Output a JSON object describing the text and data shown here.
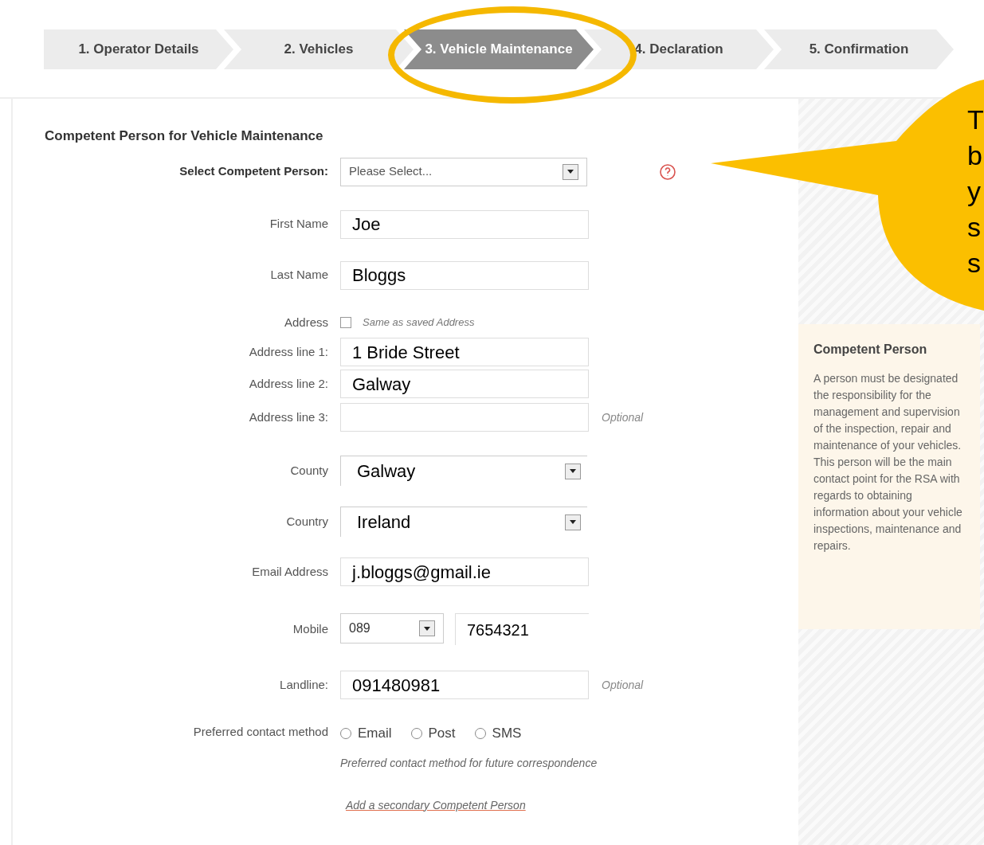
{
  "steps": [
    {
      "label": "1. Operator Details",
      "selected": false
    },
    {
      "label": "2. Vehicles",
      "selected": false
    },
    {
      "label": "3. Vehicle Maintenance",
      "selected": true
    },
    {
      "label": "4. Declaration",
      "selected": false
    },
    {
      "label": "5. Confirmation",
      "selected": false
    }
  ],
  "section_title": "Competent Person for Vehicle Maintenance",
  "fields": [
    {
      "kind": "picker",
      "label": "Select Competent Person:",
      "value": "Please Select..."
    },
    {
      "kind": "text",
      "label": "First Name",
      "value": "Joe"
    },
    {
      "kind": "text",
      "label": "Last Name",
      "value": "Bloggs"
    },
    {
      "kind": "checkbox",
      "label": "Address",
      "option": "Same as saved Address",
      "checked": false
    },
    {
      "kind": "text",
      "label": "Address line 1:",
      "value": "1 Bride Street"
    },
    {
      "kind": "text",
      "label": "Address line 2:",
      "value": "Galway"
    },
    {
      "kind": "text",
      "label": "Address line 3:",
      "note": "Optional"
    },
    {
      "kind": "select",
      "label": "County",
      "value": "Galway"
    },
    {
      "kind": "select",
      "label": "Country",
      "value": "Ireland"
    },
    {
      "kind": "text",
      "label": "Email Address",
      "value": "j.bloggs@gmail.ie"
    },
    {
      "kind": "phone",
      "label": "Mobile",
      "prefix": "089",
      "value": "7654321"
    },
    {
      "kind": "text",
      "label": "Landline:",
      "value": "091480981",
      "note": "Optional"
    },
    {
      "kind": "radio",
      "label": "Preferred contact method",
      "options": [
        {
          "label": "Email",
          "selected": false
        },
        {
          "label": "Post",
          "selected": false
        },
        {
          "label": "SMS",
          "selected": false
        }
      ],
      "hint": "Preferred contact method for future correspondence"
    }
  ],
  "link": "Add a secondary Competent Person",
  "help_panel": {
    "title": "Competent Person",
    "paragraphs": [
      "A person must be designated the responsibility for the management and supervision of the inspection, repair and maintenance of your vehicles.",
      "This person will be the main contact point for the RSA with regards to obtaining information about your vehicle inspections, maintenance and repairs."
    ]
  },
  "callout": {
    "lines": [
      "T",
      "b",
      "y",
      "s",
      "s"
    ]
  }
}
